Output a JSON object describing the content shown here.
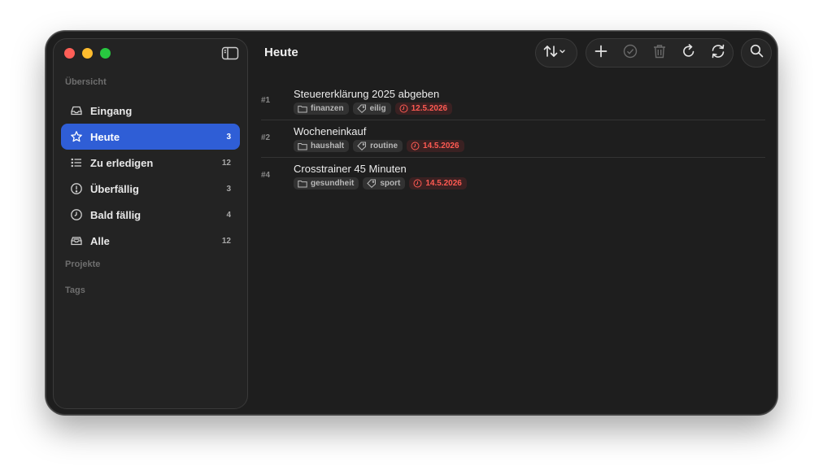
{
  "sidebar": {
    "section_overview": "Übersicht",
    "items": [
      {
        "label": "Eingang",
        "count": "",
        "icon": "inbox-icon"
      },
      {
        "label": "Heute",
        "count": "3",
        "icon": "star-icon"
      },
      {
        "label": "Zu erledigen",
        "count": "12",
        "icon": "list-icon"
      },
      {
        "label": "Überfällig",
        "count": "3",
        "icon": "exclamation-circle-icon"
      },
      {
        "label": "Bald fällig",
        "count": "4",
        "icon": "clock-icon"
      },
      {
        "label": "Alle",
        "count": "12",
        "icon": "tray-icon"
      }
    ],
    "section_projects": "Projekte",
    "section_tags": "Tags"
  },
  "header": {
    "title": "Heute"
  },
  "tasks": [
    {
      "number": "#1",
      "title": "Steuererklärung 2025 abgeben",
      "project": "finanzen",
      "tag": "eilig",
      "due": "12.5.2026"
    },
    {
      "number": "#2",
      "title": "Wocheneinkauf",
      "project": "haushalt",
      "tag": "routine",
      "due": "14.5.2026"
    },
    {
      "number": "#4",
      "title": "Crosstrainer 45 Minuten",
      "project": "gesundheit",
      "tag": "sport",
      "due": "14.5.2026"
    }
  ],
  "colors": {
    "accent": "#2f5ed6",
    "due": "#ff5a52",
    "close": "#ff5f57",
    "minimize": "#febc2e",
    "zoom": "#28c840"
  }
}
